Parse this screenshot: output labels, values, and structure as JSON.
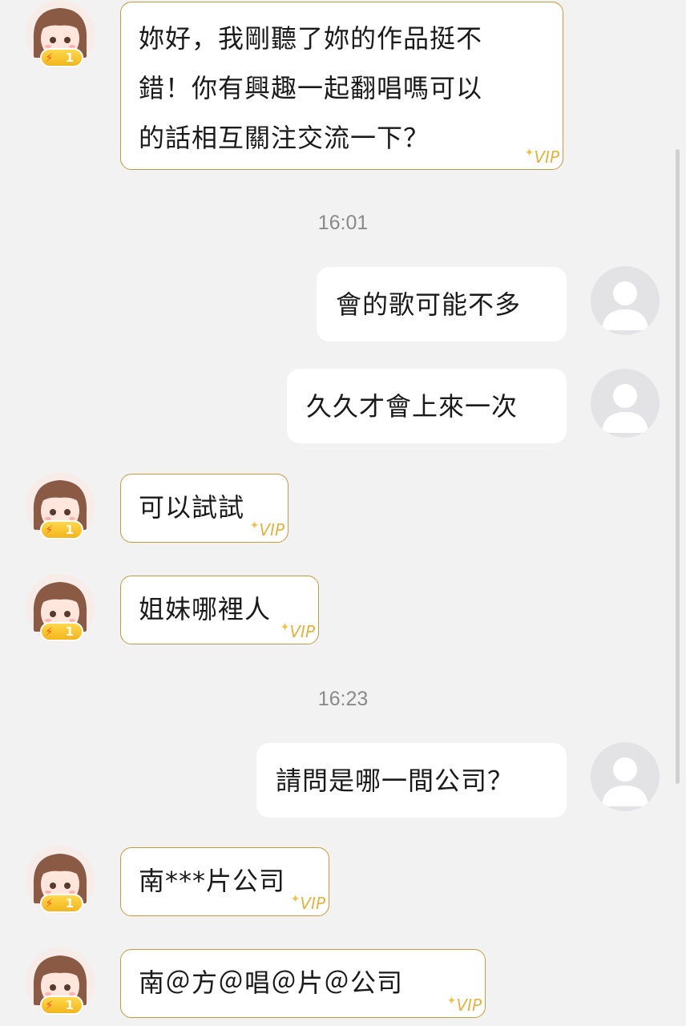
{
  "timestamps": [
    "16:01",
    "16:23"
  ],
  "badge": {
    "level": "1"
  },
  "vip_label": "VIP",
  "messages": [
    {
      "sender": "other",
      "lines": [
        "妳好，我剛聽了妳的作品挺不",
        "錯！你有興趣一起翻唱嗎可以",
        "的話相互關注交流一下？"
      ]
    },
    {
      "sender": "me",
      "text": "會的歌可能不多"
    },
    {
      "sender": "me",
      "text": "久久才會上來一次"
    },
    {
      "sender": "other",
      "text": "可以試試"
    },
    {
      "sender": "other",
      "text": "姐妹哪裡人"
    },
    {
      "sender": "me",
      "text": "請問是哪一間公司？"
    },
    {
      "sender": "other",
      "text": "南***片公司"
    },
    {
      "sender": "other",
      "text": "南＠方＠唱＠片＠公司"
    }
  ],
  "colors": {
    "background": "#f2f2f2",
    "vip_border": "#c99a3a",
    "vip_text": "#e6b23e",
    "timestamp": "#8a8a8a"
  }
}
